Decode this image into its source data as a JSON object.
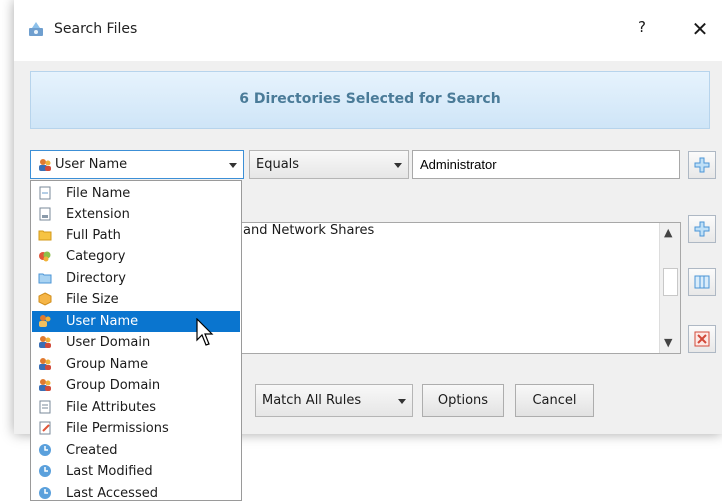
{
  "window": {
    "title": "Search Files",
    "help": "?",
    "close": "✕"
  },
  "banner": {
    "text": "6 Directories Selected for Search"
  },
  "rule": {
    "field_value": "User Name",
    "operator_value": "Equals",
    "value": "Administrator"
  },
  "list": {
    "items": [
      "and Network Shares"
    ]
  },
  "bottom": {
    "match_mode": "Match All Rules",
    "options_label": "Options",
    "cancel_label": "Cancel"
  },
  "dropdown": {
    "selected": "User Name",
    "items": [
      {
        "label": "File Name",
        "icon": "file-icon"
      },
      {
        "label": "Extension",
        "icon": "extension-icon"
      },
      {
        "label": "Full Path",
        "icon": "folder-icon"
      },
      {
        "label": "Category",
        "icon": "category-icon"
      },
      {
        "label": "Directory",
        "icon": "directory-icon"
      },
      {
        "label": "File Size",
        "icon": "box-icon"
      },
      {
        "label": "User Name",
        "icon": "user-icon"
      },
      {
        "label": "User Domain",
        "icon": "users-icon"
      },
      {
        "label": "Group Name",
        "icon": "users-icon"
      },
      {
        "label": "Group Domain",
        "icon": "users-icon"
      },
      {
        "label": "File Attributes",
        "icon": "attributes-icon"
      },
      {
        "label": "File Permissions",
        "icon": "permissions-icon"
      },
      {
        "label": "Created",
        "icon": "clock-icon"
      },
      {
        "label": "Last Modified",
        "icon": "clock-icon"
      },
      {
        "label": "Last Accessed",
        "icon": "clock-icon"
      }
    ]
  },
  "colors": {
    "selection": "#0a75cf",
    "banner_text": "#4a7b98",
    "banner_bg": "#d6eaf9"
  }
}
